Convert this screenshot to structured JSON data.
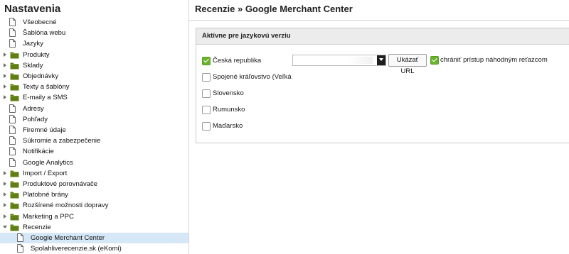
{
  "sidebar": {
    "title": "Nastavenia",
    "items": [
      {
        "label": "Všeobecné",
        "type": "page",
        "indent": 1,
        "expanded": false,
        "selected": false
      },
      {
        "label": "Šablóna webu",
        "type": "page",
        "indent": 1,
        "expanded": false,
        "selected": false
      },
      {
        "label": "Jazyky",
        "type": "page",
        "indent": 1,
        "expanded": false,
        "selected": false
      },
      {
        "label": "Produkty",
        "type": "folder",
        "indent": 0,
        "expanded": false,
        "selected": false
      },
      {
        "label": "Sklady",
        "type": "folder",
        "indent": 0,
        "expanded": false,
        "selected": false
      },
      {
        "label": "Objednávky",
        "type": "folder",
        "indent": 0,
        "expanded": false,
        "selected": false
      },
      {
        "label": "Texty a šablóny",
        "type": "folder",
        "indent": 0,
        "expanded": false,
        "selected": false
      },
      {
        "label": "E-maily a SMS",
        "type": "folder",
        "indent": 0,
        "expanded": false,
        "selected": false
      },
      {
        "label": "Adresy",
        "type": "page",
        "indent": 1,
        "expanded": false,
        "selected": false
      },
      {
        "label": "Pohľady",
        "type": "page",
        "indent": 1,
        "expanded": false,
        "selected": false
      },
      {
        "label": "Firemné údaje",
        "type": "page",
        "indent": 1,
        "expanded": false,
        "selected": false
      },
      {
        "label": "Súkromie a zabezpečenie",
        "type": "page",
        "indent": 1,
        "expanded": false,
        "selected": false
      },
      {
        "label": "Notifikácie",
        "type": "page",
        "indent": 1,
        "expanded": false,
        "selected": false
      },
      {
        "label": "Google Analytics",
        "type": "page",
        "indent": 1,
        "expanded": false,
        "selected": false
      },
      {
        "label": "Import / Export",
        "type": "folder",
        "indent": 0,
        "expanded": false,
        "selected": false
      },
      {
        "label": "Produktové porovnávače",
        "type": "folder",
        "indent": 0,
        "expanded": false,
        "selected": false
      },
      {
        "label": "Platobné brány",
        "type": "folder",
        "indent": 0,
        "expanded": false,
        "selected": false
      },
      {
        "label": "Rozšírené možnosti dopravy",
        "type": "folder",
        "indent": 0,
        "expanded": false,
        "selected": false
      },
      {
        "label": "Marketing a PPC",
        "type": "folder",
        "indent": 0,
        "expanded": false,
        "selected": false
      },
      {
        "label": "Recenzie",
        "type": "folder",
        "indent": 0,
        "expanded": true,
        "selected": false
      },
      {
        "label": "Google Merchant Center",
        "type": "page",
        "indent": 2,
        "expanded": false,
        "selected": true
      },
      {
        "label": "Spolahliverecenzie.sk (eKomi)",
        "type": "page",
        "indent": 2,
        "expanded": false,
        "selected": false
      }
    ]
  },
  "main": {
    "title": "Recenzie » Google Merchant Center",
    "panel": {
      "header": "Aktívne pre jazykovú verziu",
      "countries": [
        {
          "label": "Česká republika",
          "checked": true
        },
        {
          "label": "Spojené kráľovstvo (Veľká",
          "checked": false
        },
        {
          "label": "Slovensko",
          "checked": false
        },
        {
          "label": "Rumunsko",
          "checked": false
        },
        {
          "label": "Maďarsko",
          "checked": false
        }
      ],
      "url_select": {
        "value": ""
      },
      "show_url_button": "Ukázať URL",
      "protect_checkbox": {
        "label": "chrániť prístup náhodným reťazcom",
        "checked": true
      }
    }
  },
  "colors": {
    "folder": "#5f7f14",
    "check_green": "#6bb32e",
    "selected_row": "#d6e8f7"
  }
}
